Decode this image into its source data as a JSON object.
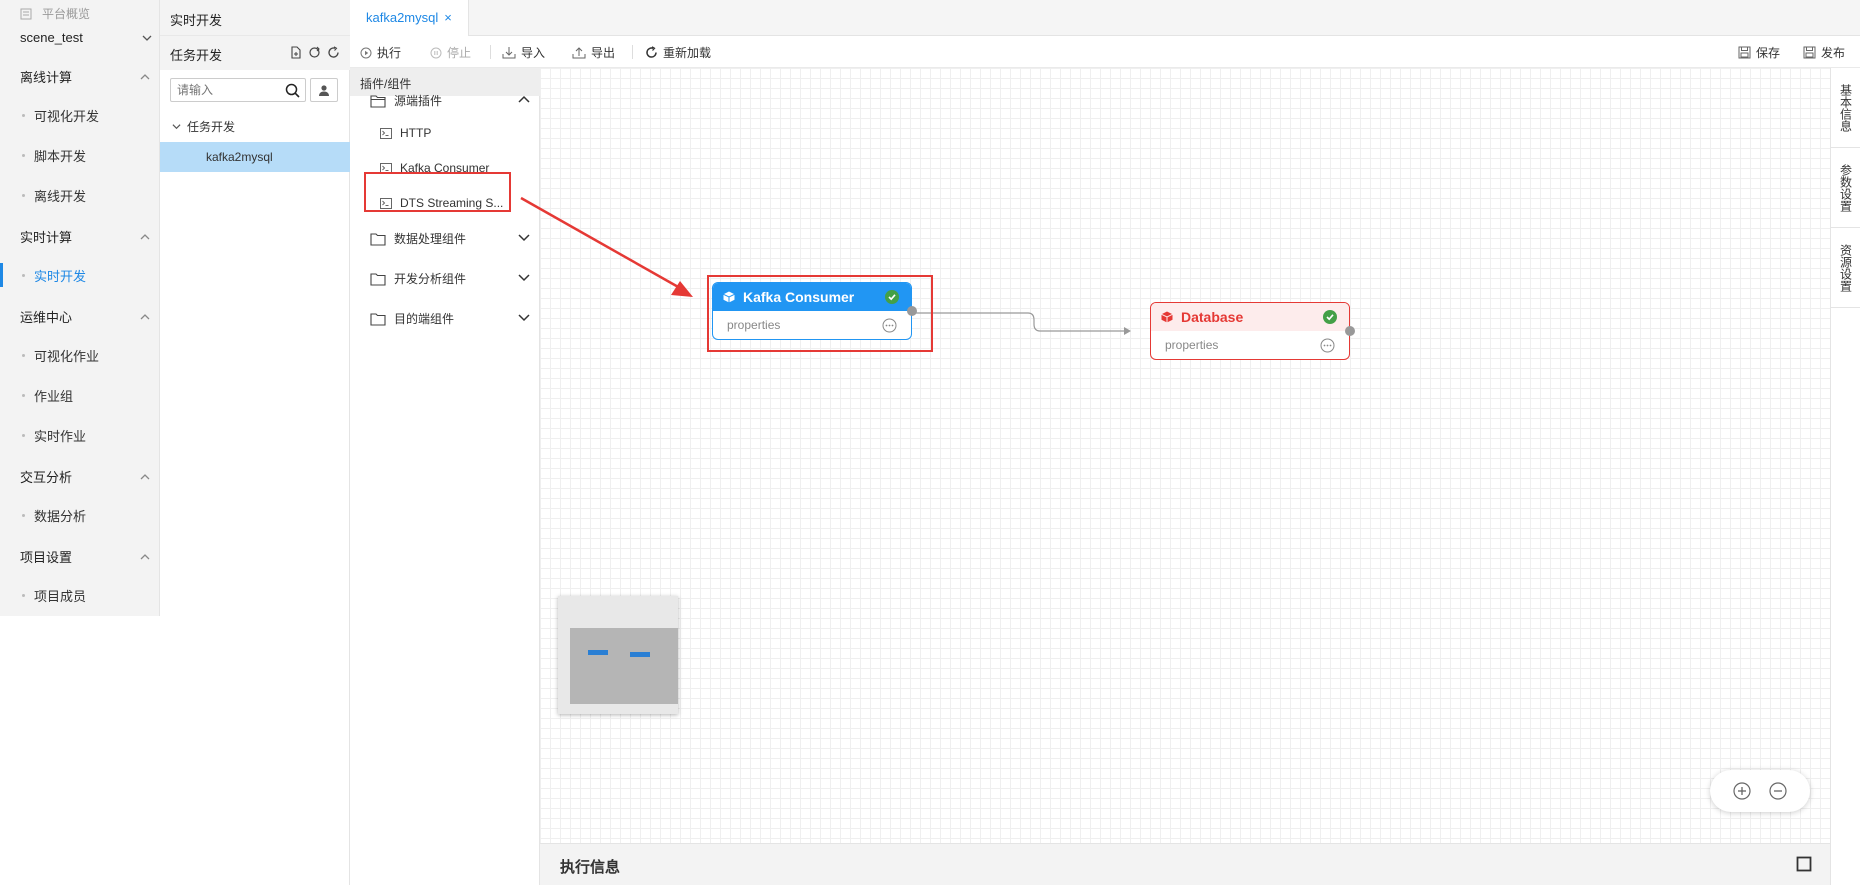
{
  "leftnav": {
    "overview": "平台概览",
    "project": "scene_test",
    "sections": [
      {
        "title": "离线计算",
        "items": [
          "可视化开发",
          "脚本开发",
          "离线开发"
        ]
      },
      {
        "title": "实时计算",
        "items": [
          "实时开发"
        ]
      },
      {
        "title": "运维中心",
        "items": [
          "可视化作业",
          "作业组",
          "实时作业"
        ]
      },
      {
        "title": "交互分析",
        "items": [
          "数据分析"
        ]
      },
      {
        "title": "项目设置",
        "items": [
          "项目成员"
        ]
      }
    ],
    "active_item": "实时开发"
  },
  "taskpanel": {
    "title": "实时开发",
    "subtitle": "任务开发",
    "search_placeholder": "请输入",
    "tree_root": "任务开发",
    "tree_item": "kafka2mysql"
  },
  "tabs": [
    {
      "label": "kafka2mysql",
      "close": "×"
    }
  ],
  "toolbar": {
    "run": "执行",
    "stop": "停止",
    "import": "导入",
    "export": "导出",
    "reload": "重新加载",
    "save": "保存",
    "publish": "发布"
  },
  "plugins": {
    "header": "插件/组件",
    "groups": [
      {
        "label": "源端插件",
        "expanded": true,
        "items": [
          "HTTP",
          "Kafka Consumer",
          "DTS Streaming S..."
        ]
      },
      {
        "label": "数据处理组件",
        "expanded": false,
        "items": []
      },
      {
        "label": "开发分析组件",
        "expanded": false,
        "items": []
      },
      {
        "label": "目的端组件",
        "expanded": false,
        "items": []
      }
    ]
  },
  "canvas": {
    "nodes": [
      {
        "title": "Kafka Consumer",
        "props": "properties",
        "color": "#2196f3"
      },
      {
        "title": "Database",
        "props": "properties",
        "color": "#e53935"
      }
    ]
  },
  "exec_info": {
    "title": "执行信息"
  },
  "right_tabs": [
    "基本信息",
    "参数设置",
    "资源设置"
  ],
  "colors": {
    "accent": "#1e88e5",
    "highlight": "#e53935",
    "selected_row": "#b6dcf8"
  }
}
